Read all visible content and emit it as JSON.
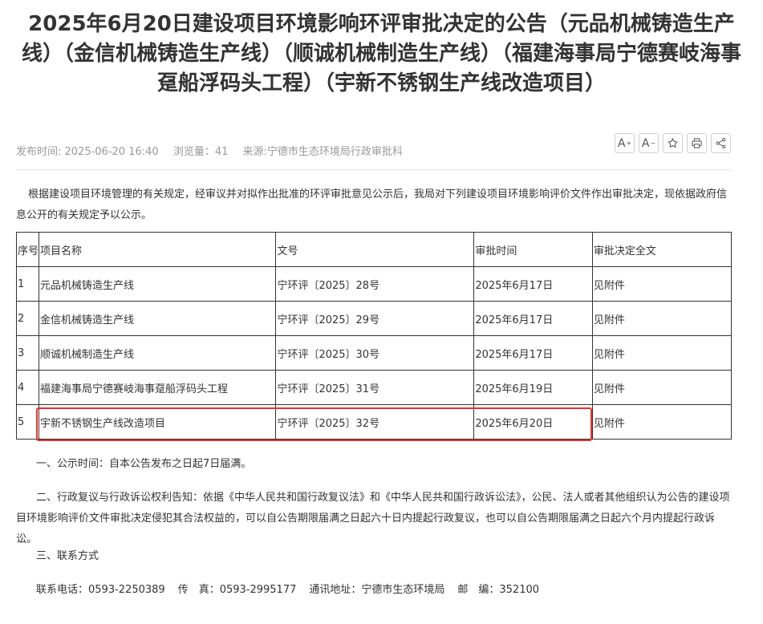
{
  "title": "2025年6月20日建设项目环境影响环评审批决定的公告（元品机械铸造生产线）（金信机械铸造生产线）（顺诚机械制造生产线）（福建海事局宁德赛岐海事趸船浮码头工程）（宇新不锈钢生产线改造项目）",
  "meta": {
    "publish_time": "发布时间: 2025-06-20 16:40",
    "views": "浏览量：41",
    "source": "来源:宁德市生态环境局行政审批科"
  },
  "tools": {
    "font_larger": "A",
    "font_larger_mark": "+",
    "font_smaller": "A",
    "font_smaller_mark": "−"
  },
  "intro": "根据建设项目环境管理的有关规定，经审议并对拟作出批准的环评审批意见公示后，我局对下列建设项目环境影响评价文件作出审批决定，现依据政府信息公开的有关规定予以公示。",
  "table": {
    "headers": [
      "序号",
      "项目名称",
      "文号",
      "审批时间",
      "审批决定全文"
    ],
    "rows": [
      [
        "1",
        "元品机械铸造生产线",
        "宁环评〔2025〕28号",
        "2025年6月17日",
        "见附件"
      ],
      [
        "2",
        "金信机械铸造生产线",
        "宁环评〔2025〕29号",
        "2025年6月17日",
        "见附件"
      ],
      [
        "3",
        "顺诚机械制造生产线",
        "宁环评〔2025〕30号",
        "2025年6月17日",
        "见附件"
      ],
      [
        "4",
        "福建海事局宁德赛岐海事趸船浮码头工程",
        "宁环评〔2025〕31号",
        "2025年6月19日",
        "见附件"
      ],
      [
        "5",
        "宇新不锈钢生产线改造项目",
        "宁环评〔2025〕32号",
        "2025年6月20日",
        "见附件"
      ]
    ]
  },
  "notice_period": "一、公示时间：自本公告发布之日起7日届满。",
  "appeal": "二、行政复议与行政诉讼权利告知：依据《中华人民共和国行政复议法》和《中华人民共和国行政诉讼法》，公民、法人或者其他组织认为公告的建设项目环境影响评价文件审批决定侵犯其合法权益的，可以自公告期限届满之日起六十日内提起行政复议，也可以自公告期限届满之日起六个月内提起行政诉讼。",
  "contact_heading": "三、联系方式",
  "contact": {
    "phone": "联系电话：0593-2250389",
    "fax": "传　真：0593-2995177",
    "address": "通讯地址：宁德市生态环境局",
    "postcode": "邮　编：352100"
  },
  "colors": {
    "highlight": "#e8322d",
    "text": "#333333",
    "meta": "#999999"
  }
}
